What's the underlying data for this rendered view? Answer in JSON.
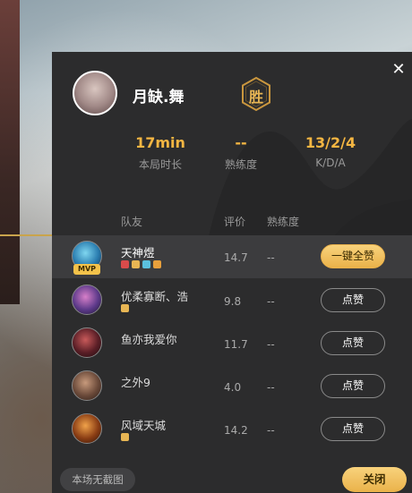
{
  "player": {
    "name": "月缺.舞",
    "result": "胜"
  },
  "stats": [
    {
      "value": "17min",
      "label": "本局时长"
    },
    {
      "value": "--",
      "label": "熟练度"
    },
    {
      "value": "13/2/4",
      "label": "K/D/A"
    }
  ],
  "table_headers": {
    "teammate": "队友",
    "rating": "评价",
    "proficiency": "熟练度"
  },
  "teammates": [
    {
      "name": "天神煜",
      "score": "14.7",
      "proficiency": "--",
      "button": "一键全赞",
      "mvp": "MVP",
      "selected": true
    },
    {
      "name": "优柔寡断、浩",
      "score": "9.8",
      "proficiency": "--",
      "button": "点赞"
    },
    {
      "name": "鱼亦我爱你",
      "score": "11.7",
      "proficiency": "--",
      "button": "点赞"
    },
    {
      "name": "之外9",
      "score": "4.0",
      "proficiency": "--",
      "button": "点赞"
    },
    {
      "name": "风域天城",
      "score": "14.2",
      "proficiency": "--",
      "button": "点赞"
    }
  ],
  "footer": {
    "no_screenshot": "本场无截图",
    "close": "关闭"
  },
  "colors": {
    "accent_gold": "#f5b642",
    "panel_bg": "#2c2c2d",
    "button_gold": "#eab24a"
  },
  "icons": {
    "close": "close-icon",
    "win_badge": "hexagon-badge-icon"
  }
}
